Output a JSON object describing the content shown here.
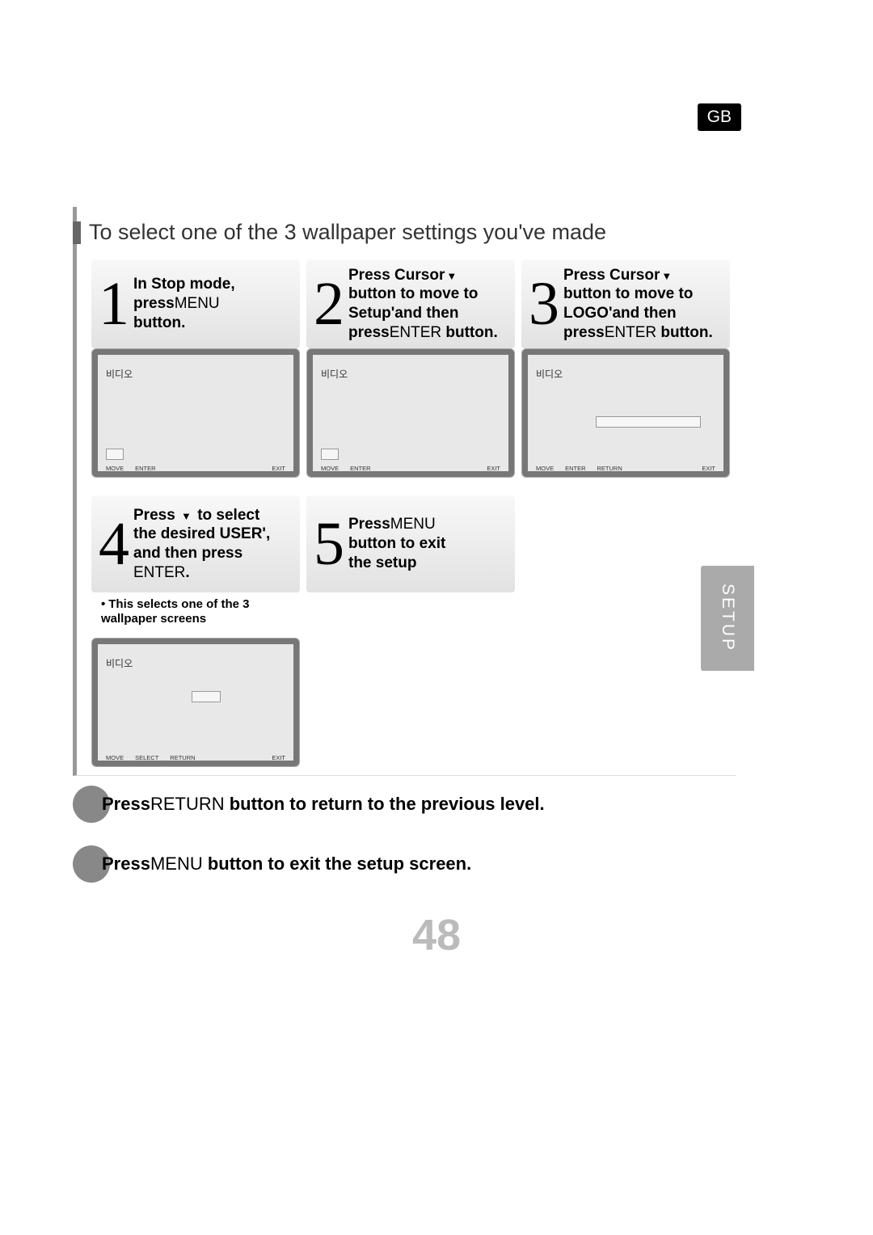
{
  "lang_badge": "GB",
  "section_title": "To select one of the 3 wallpaper settings you've made",
  "steps": {
    "s1": {
      "num": "1",
      "line1_a": "In Stop mode,",
      "line2_a": "press",
      "line2_b": "MENU",
      "line3_a": "button."
    },
    "s2": {
      "num": "2",
      "line1_a": "Press Cursor",
      "line2_a": "button to move to",
      "line3_a": "Setup'and then",
      "line4_a": "press",
      "line4_b": "ENTER",
      "line4_c": " button."
    },
    "s3": {
      "num": "3",
      "line1_a": "Press Cursor",
      "line2_a": "button to move to",
      "line3_a": "LOGO'and then",
      "line4_a": "press",
      "line4_b": "ENTER",
      "line4_c": " button."
    },
    "s4": {
      "num": "4",
      "line1_a": "Press ",
      "line1_b": " to select",
      "line2_a": "the desired USER',",
      "line3_a": "and then press",
      "line4_a": "ENTER",
      "line4_b": "."
    },
    "s5": {
      "num": "5",
      "line1_a": "Press",
      "line1_b": "MENU",
      "line2_a": "button to exit",
      "line3_a": "the setup"
    }
  },
  "note_s4": "This selects one of the 3 wallpaper screens",
  "screen": {
    "kr": "비디오",
    "foot_move": "MOVE",
    "foot_enter": "ENTER",
    "foot_select": "SELECT",
    "foot_return": "RETURN",
    "foot_exit": "EXIT"
  },
  "side_tab": "SETUP",
  "footer": {
    "line1_a": "Press",
    "line1_b": "RETURN",
    "line1_c": " button to return to the previous level.",
    "line2_a": "Press",
    "line2_b": "MENU",
    "line2_c": " button to exit the setup screen."
  },
  "page_number": "48"
}
